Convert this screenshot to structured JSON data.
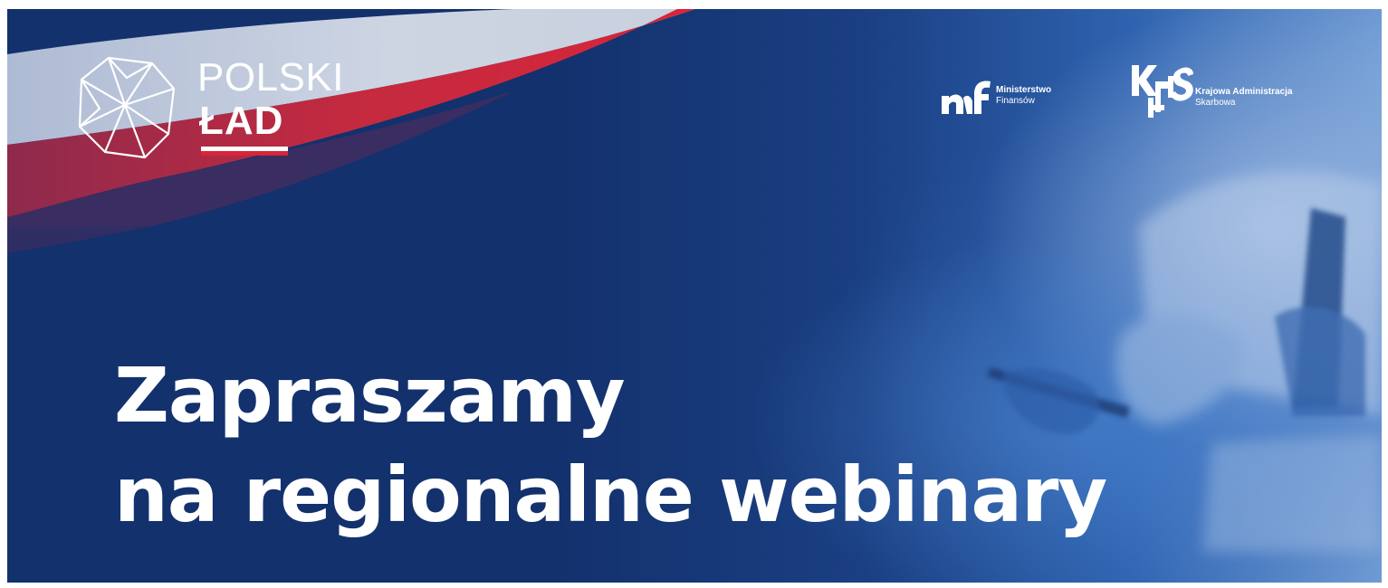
{
  "brand": {
    "polski": "POLSKI",
    "lad": "ŁAD"
  },
  "partners": {
    "mf": {
      "line1": "Ministerstwo",
      "line2": "Finansów"
    },
    "kas": {
      "line1": "Krajowa Administracja",
      "line2": "Skarbowa"
    }
  },
  "headline": {
    "line1": "Zapraszamy",
    "line2": "na regionalne webinary"
  },
  "colors": {
    "background": "#13316d",
    "accent_red": "#d8253a",
    "text": "#ffffff"
  },
  "icons": [
    "poland-map-icon",
    "mf-logo-icon",
    "kas-logo-icon"
  ]
}
